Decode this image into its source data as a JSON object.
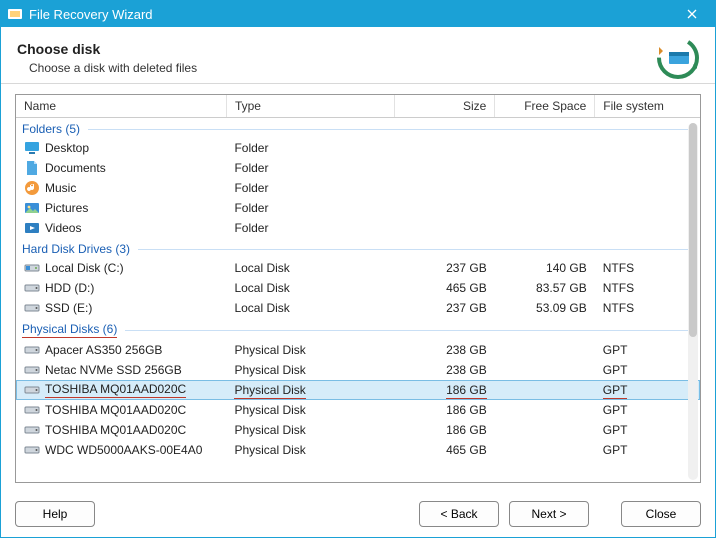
{
  "window": {
    "title": "File Recovery Wizard"
  },
  "header": {
    "heading": "Choose disk",
    "sub": "Choose a disk with deleted files"
  },
  "columns": {
    "name": "Name",
    "type": "Type",
    "size": "Size",
    "free": "Free Space",
    "fs": "File system"
  },
  "groups": {
    "folders": {
      "label": "Folders (5)"
    },
    "hdd": {
      "label": "Hard Disk Drives (3)"
    },
    "phys": {
      "label": "Physical Disks (6)",
      "underline": true
    }
  },
  "rows": {
    "folders": [
      {
        "name": "Desktop",
        "type": "Folder",
        "icon": "desktop"
      },
      {
        "name": "Documents",
        "type": "Folder",
        "icon": "docs"
      },
      {
        "name": "Music",
        "type": "Folder",
        "icon": "music"
      },
      {
        "name": "Pictures",
        "type": "Folder",
        "icon": "pics"
      },
      {
        "name": "Videos",
        "type": "Folder",
        "icon": "video"
      }
    ],
    "hdd": [
      {
        "name": "Local Disk (C:)",
        "type": "Local Disk",
        "size": "237 GB",
        "free": "140 GB",
        "fs": "NTFS",
        "icon": "localdisk"
      },
      {
        "name": "HDD (D:)",
        "type": "Local Disk",
        "size": "465 GB",
        "free": "83.57 GB",
        "fs": "NTFS",
        "icon": "hdd"
      },
      {
        "name": "SSD (E:)",
        "type": "Local Disk",
        "size": "237 GB",
        "free": "53.09 GB",
        "fs": "NTFS",
        "icon": "hdd"
      }
    ],
    "phys": [
      {
        "name": "Apacer AS350 256GB",
        "type": "Physical Disk",
        "size": "238 GB",
        "fs": "GPT",
        "icon": "hdd"
      },
      {
        "name": "Netac NVMe SSD 256GB",
        "type": "Physical Disk",
        "size": "238 GB",
        "fs": "GPT",
        "icon": "hdd"
      },
      {
        "name": "TOSHIBA MQ01AAD020C",
        "type": "Physical Disk",
        "size": "186 GB",
        "fs": "GPT",
        "icon": "hdd",
        "selected": true,
        "underline": true
      },
      {
        "name": "TOSHIBA MQ01AAD020C",
        "type": "Physical Disk",
        "size": "186 GB",
        "fs": "GPT",
        "icon": "hdd"
      },
      {
        "name": "TOSHIBA MQ01AAD020C",
        "type": "Physical Disk",
        "size": "186 GB",
        "fs": "GPT",
        "icon": "hdd"
      },
      {
        "name": "WDC WD5000AAKS-00E4A0",
        "type": "Physical Disk",
        "size": "465 GB",
        "fs": "GPT",
        "icon": "hdd"
      }
    ]
  },
  "buttons": {
    "help": "Help",
    "back": "< Back",
    "next": "Next >",
    "close": "Close"
  }
}
